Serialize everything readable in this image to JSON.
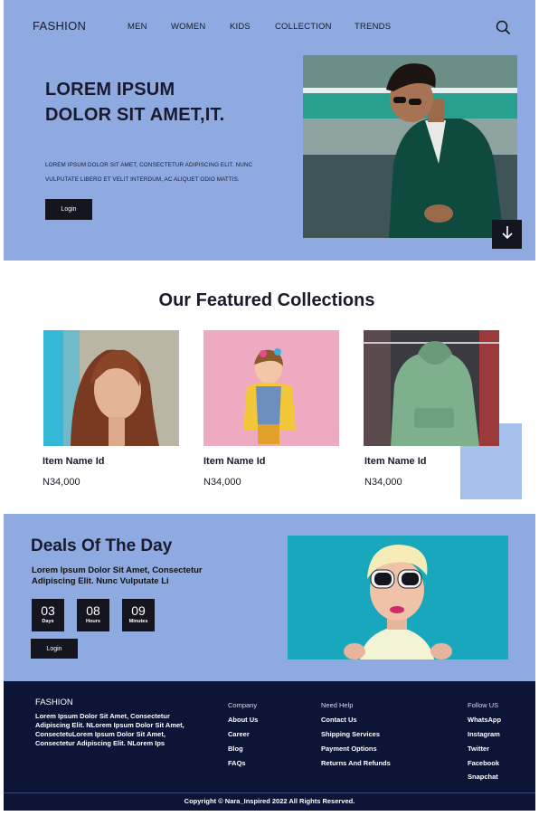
{
  "header": {
    "logo": "FASHION",
    "nav": [
      "MEN",
      "WOMEN",
      "KIDS",
      "COLLECTION",
      "TRENDS"
    ]
  },
  "hero": {
    "title": "LOREM IPSUM DOLOR SIT AMET,IT.",
    "subtitle": "LOREM IPSUM DOLOR SIT AMET, CONSECTETUR ADIPISCING ELIT. NUNC VULPUTATE LIBERO ET VELIT INTERDUM, AC ALIQUET ODIO MATTIS.",
    "button": "Login"
  },
  "featured": {
    "title": "Our Featured Collections",
    "items": [
      {
        "name": "Item Name Id",
        "price": "N34,000"
      },
      {
        "name": "Item Name Id",
        "price": "N34,000"
      },
      {
        "name": "Item Name Id",
        "price": "N34,000"
      }
    ]
  },
  "deals": {
    "title": "Deals Of The Day",
    "subtitle": "Lorem Ipsum Dolor Sit Amet, Consectetur Adipiscing Elit. Nunc Vulputate Li",
    "countdown": [
      {
        "value": "03",
        "label": "Days"
      },
      {
        "value": "08",
        "label": "Hours"
      },
      {
        "value": "09",
        "label": "Minutes"
      }
    ],
    "button": "Login"
  },
  "footer": {
    "brand": "FASHION",
    "description": "Lorem Ipsum Dolor Sit Amet, Consectetur Adipiscing Elit. NLorem Ipsum Dolor Sit Amet, ConsectetuLorem Ipsum Dolor Sit Amet, Consectetur Adipiscing Elit. NLorem Ips",
    "company": {
      "heading": "Company",
      "links": [
        "About Us",
        "Career",
        "Blog",
        "FAQs"
      ]
    },
    "help": {
      "heading": "Need Help",
      "links": [
        "Contact Us",
        "Shipping Services",
        "Payment Options",
        "Returns And Refunds"
      ]
    },
    "follow": {
      "heading": "Follow US",
      "links": [
        "WhatsApp",
        "Instagram",
        "Twitter",
        "Facebook",
        "Snapchat"
      ]
    },
    "copyright": "Copyright © Nara_Inspired 2022 All Rights Reserved."
  },
  "colors": {
    "primary_blue": "#8eaae0",
    "accent_light_blue": "#a5c0ea",
    "dark": "#15151f",
    "footer_navy": "#0c1535"
  },
  "icons": [
    "search-icon",
    "arrow-down-icon"
  ]
}
